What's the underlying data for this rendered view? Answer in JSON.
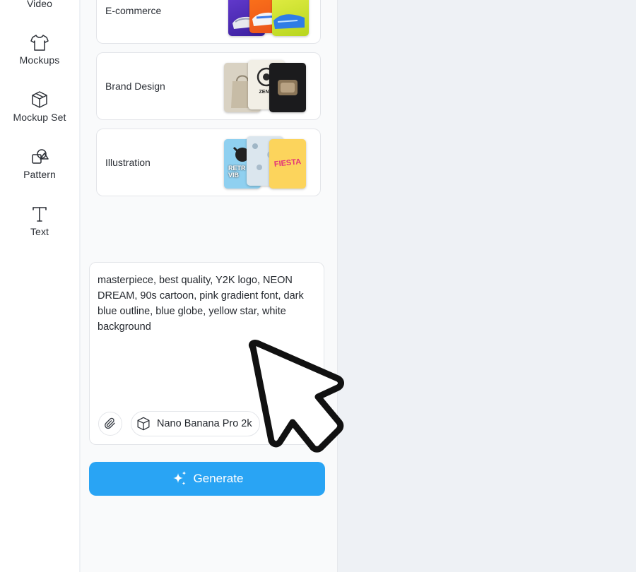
{
  "rail": {
    "items": [
      {
        "label": "Video",
        "icon": "video-icon"
      },
      {
        "label": "Mockups",
        "icon": "tshirt-icon"
      },
      {
        "label": "Mockup Set",
        "icon": "cube-icon"
      },
      {
        "label": "Pattern",
        "icon": "shapes-icon"
      },
      {
        "label": "Text",
        "icon": "text-icon"
      }
    ]
  },
  "categories": [
    {
      "label": "E-commerce"
    },
    {
      "label": "Brand Design"
    },
    {
      "label": "Illustration"
    }
  ],
  "thumb_text": {
    "zen": "ZEN R",
    "retro": "RETR VIB",
    "fiesta": "FIESTA"
  },
  "prompt": {
    "text": "masterpiece, best quality, Y2K logo, NEON DREAM, 90s cartoon, pink gradient font, dark blue outline, blue globe, yellow star, white background"
  },
  "model": {
    "label": "Nano Banana Pro 2k",
    "icon": "cube-icon"
  },
  "attach": {
    "icon": "paperclip-icon"
  },
  "generate": {
    "label": "Generate",
    "icon": "sparkle-icon",
    "color": "#29a4f4"
  }
}
